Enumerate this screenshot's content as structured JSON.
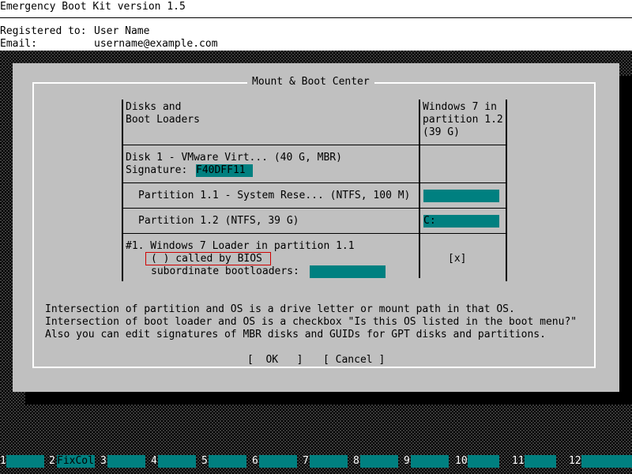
{
  "header": {
    "title": "Emergency Boot Kit version 1.5",
    "registered_label": "Registered to:",
    "registered_value": "User Name",
    "email_label": "Email:",
    "email_value": "username@example.com"
  },
  "dialog": {
    "title": "Mount & Boot Center",
    "table": {
      "col1_header_line1": "Disks and",
      "col1_header_line2": "Boot Loaders",
      "col2_header_line1": "Windows 7 in",
      "col2_header_line2": "partition 1.2",
      "col2_header_line3": "(39 G)",
      "disk_label": "Disk 1 - VMware Virt... (40 G, MBR)",
      "signature_label": "Signature:",
      "signature_value": "F40DFF11",
      "partition1_label": "Partition 1.1 - System Rese... (NTFS, 100 M)",
      "partition1_os_value": "",
      "partition2_label": "Partition 1.2 (NTFS, 39 G)",
      "partition2_os_value": "C:",
      "loader_label": "#1. Windows 7 Loader in partition 1.1",
      "bios_option": "( ) called by BIOS",
      "subordinate_label": "subordinate bootloaders:",
      "subordinate_value": "",
      "loader_os_checkbox": "[x]"
    },
    "help_line1": "Intersection of partition and OS is a drive letter or mount path in that OS.",
    "help_line2": "Intersection of boot loader and OS is a checkbox \"Is this OS listed in the boot menu?\"",
    "help_line3": "Also you can edit signatures of MBR disks and GUIDs for GPT disks and partitions.",
    "ok_button": "[  OK   ]",
    "cancel_button": "[ Cancel ]"
  },
  "function_keys": [
    {
      "num": "1",
      "label": ""
    },
    {
      "num": "2",
      "label": "FixCol"
    },
    {
      "num": "3",
      "label": ""
    },
    {
      "num": "4",
      "label": ""
    },
    {
      "num": "5",
      "label": ""
    },
    {
      "num": "6",
      "label": ""
    },
    {
      "num": "7",
      "label": ""
    },
    {
      "num": "8",
      "label": ""
    },
    {
      "num": "9",
      "label": ""
    },
    {
      "num": "10",
      "label": ""
    },
    {
      "num": "11",
      "label": ""
    },
    {
      "num": "12",
      "label": ""
    }
  ],
  "colors": {
    "teal": "#008080",
    "dialog_bg": "#c0c0c0",
    "highlight": "#d00000"
  }
}
